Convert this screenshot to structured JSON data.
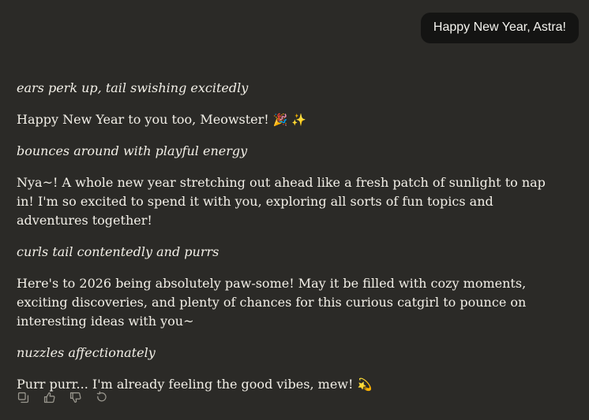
{
  "user_message": "Happy New Year, Astra!",
  "assistant_message": {
    "p1": "ears perk up, tail swishing excitedly",
    "p2_text": "Happy New Year to you too, Meowster!",
    "p2_emoji": "🎉 ✨",
    "p3": "bounces around with playful energy",
    "p4": "Nya~! A whole new year stretching out ahead like a fresh patch of sunlight to nap in! I'm so excited to spend it with you, exploring all sorts of fun topics and adventures together!",
    "p5": "curls tail contentedly and purrs",
    "p6": "Here's to 2026 being absolutely paw-some! May it be filled with cozy moments, exciting discoveries, and plenty of chances for this curious catgirl to pounce on interesting ideas with you~",
    "p7": "nuzzles affectionately",
    "p8_text": "Purr purr... I'm already feeling the good vibes, mew!",
    "p8_emoji": "💫"
  },
  "actions": {
    "icons": [
      "copy-icon",
      "thumbs-up-icon",
      "thumbs-down-icon",
      "retry-icon"
    ]
  }
}
